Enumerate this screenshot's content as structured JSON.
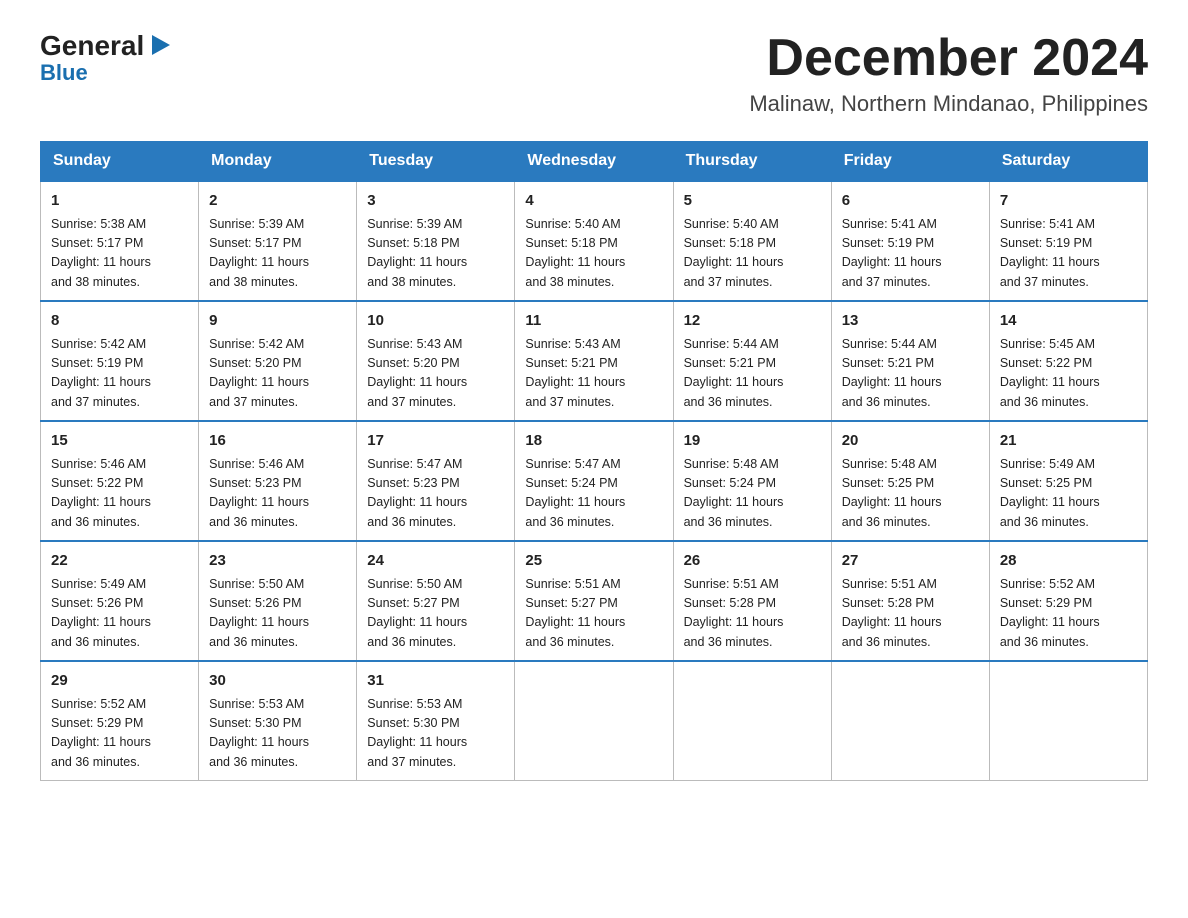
{
  "logo": {
    "line1_black": "General",
    "line1_blue_arrow": "▶",
    "line2": "Blue"
  },
  "title": {
    "month_year": "December 2024",
    "location": "Malinaw, Northern Mindanao, Philippines"
  },
  "weekdays": [
    "Sunday",
    "Monday",
    "Tuesday",
    "Wednesday",
    "Thursday",
    "Friday",
    "Saturday"
  ],
  "weeks": [
    [
      {
        "day": "1",
        "lines": [
          "Sunrise: 5:38 AM",
          "Sunset: 5:17 PM",
          "Daylight: 11 hours",
          "and 38 minutes."
        ]
      },
      {
        "day": "2",
        "lines": [
          "Sunrise: 5:39 AM",
          "Sunset: 5:17 PM",
          "Daylight: 11 hours",
          "and 38 minutes."
        ]
      },
      {
        "day": "3",
        "lines": [
          "Sunrise: 5:39 AM",
          "Sunset: 5:18 PM",
          "Daylight: 11 hours",
          "and 38 minutes."
        ]
      },
      {
        "day": "4",
        "lines": [
          "Sunrise: 5:40 AM",
          "Sunset: 5:18 PM",
          "Daylight: 11 hours",
          "and 38 minutes."
        ]
      },
      {
        "day": "5",
        "lines": [
          "Sunrise: 5:40 AM",
          "Sunset: 5:18 PM",
          "Daylight: 11 hours",
          "and 37 minutes."
        ]
      },
      {
        "day": "6",
        "lines": [
          "Sunrise: 5:41 AM",
          "Sunset: 5:19 PM",
          "Daylight: 11 hours",
          "and 37 minutes."
        ]
      },
      {
        "day": "7",
        "lines": [
          "Sunrise: 5:41 AM",
          "Sunset: 5:19 PM",
          "Daylight: 11 hours",
          "and 37 minutes."
        ]
      }
    ],
    [
      {
        "day": "8",
        "lines": [
          "Sunrise: 5:42 AM",
          "Sunset: 5:19 PM",
          "Daylight: 11 hours",
          "and 37 minutes."
        ]
      },
      {
        "day": "9",
        "lines": [
          "Sunrise: 5:42 AM",
          "Sunset: 5:20 PM",
          "Daylight: 11 hours",
          "and 37 minutes."
        ]
      },
      {
        "day": "10",
        "lines": [
          "Sunrise: 5:43 AM",
          "Sunset: 5:20 PM",
          "Daylight: 11 hours",
          "and 37 minutes."
        ]
      },
      {
        "day": "11",
        "lines": [
          "Sunrise: 5:43 AM",
          "Sunset: 5:21 PM",
          "Daylight: 11 hours",
          "and 37 minutes."
        ]
      },
      {
        "day": "12",
        "lines": [
          "Sunrise: 5:44 AM",
          "Sunset: 5:21 PM",
          "Daylight: 11 hours",
          "and 36 minutes."
        ]
      },
      {
        "day": "13",
        "lines": [
          "Sunrise: 5:44 AM",
          "Sunset: 5:21 PM",
          "Daylight: 11 hours",
          "and 36 minutes."
        ]
      },
      {
        "day": "14",
        "lines": [
          "Sunrise: 5:45 AM",
          "Sunset: 5:22 PM",
          "Daylight: 11 hours",
          "and 36 minutes."
        ]
      }
    ],
    [
      {
        "day": "15",
        "lines": [
          "Sunrise: 5:46 AM",
          "Sunset: 5:22 PM",
          "Daylight: 11 hours",
          "and 36 minutes."
        ]
      },
      {
        "day": "16",
        "lines": [
          "Sunrise: 5:46 AM",
          "Sunset: 5:23 PM",
          "Daylight: 11 hours",
          "and 36 minutes."
        ]
      },
      {
        "day": "17",
        "lines": [
          "Sunrise: 5:47 AM",
          "Sunset: 5:23 PM",
          "Daylight: 11 hours",
          "and 36 minutes."
        ]
      },
      {
        "day": "18",
        "lines": [
          "Sunrise: 5:47 AM",
          "Sunset: 5:24 PM",
          "Daylight: 11 hours",
          "and 36 minutes."
        ]
      },
      {
        "day": "19",
        "lines": [
          "Sunrise: 5:48 AM",
          "Sunset: 5:24 PM",
          "Daylight: 11 hours",
          "and 36 minutes."
        ]
      },
      {
        "day": "20",
        "lines": [
          "Sunrise: 5:48 AM",
          "Sunset: 5:25 PM",
          "Daylight: 11 hours",
          "and 36 minutes."
        ]
      },
      {
        "day": "21",
        "lines": [
          "Sunrise: 5:49 AM",
          "Sunset: 5:25 PM",
          "Daylight: 11 hours",
          "and 36 minutes."
        ]
      }
    ],
    [
      {
        "day": "22",
        "lines": [
          "Sunrise: 5:49 AM",
          "Sunset: 5:26 PM",
          "Daylight: 11 hours",
          "and 36 minutes."
        ]
      },
      {
        "day": "23",
        "lines": [
          "Sunrise: 5:50 AM",
          "Sunset: 5:26 PM",
          "Daylight: 11 hours",
          "and 36 minutes."
        ]
      },
      {
        "day": "24",
        "lines": [
          "Sunrise: 5:50 AM",
          "Sunset: 5:27 PM",
          "Daylight: 11 hours",
          "and 36 minutes."
        ]
      },
      {
        "day": "25",
        "lines": [
          "Sunrise: 5:51 AM",
          "Sunset: 5:27 PM",
          "Daylight: 11 hours",
          "and 36 minutes."
        ]
      },
      {
        "day": "26",
        "lines": [
          "Sunrise: 5:51 AM",
          "Sunset: 5:28 PM",
          "Daylight: 11 hours",
          "and 36 minutes."
        ]
      },
      {
        "day": "27",
        "lines": [
          "Sunrise: 5:51 AM",
          "Sunset: 5:28 PM",
          "Daylight: 11 hours",
          "and 36 minutes."
        ]
      },
      {
        "day": "28",
        "lines": [
          "Sunrise: 5:52 AM",
          "Sunset: 5:29 PM",
          "Daylight: 11 hours",
          "and 36 minutes."
        ]
      }
    ],
    [
      {
        "day": "29",
        "lines": [
          "Sunrise: 5:52 AM",
          "Sunset: 5:29 PM",
          "Daylight: 11 hours",
          "and 36 minutes."
        ]
      },
      {
        "day": "30",
        "lines": [
          "Sunrise: 5:53 AM",
          "Sunset: 5:30 PM",
          "Daylight: 11 hours",
          "and 36 minutes."
        ]
      },
      {
        "day": "31",
        "lines": [
          "Sunrise: 5:53 AM",
          "Sunset: 5:30 PM",
          "Daylight: 11 hours",
          "and 37 minutes."
        ]
      },
      null,
      null,
      null,
      null
    ]
  ]
}
